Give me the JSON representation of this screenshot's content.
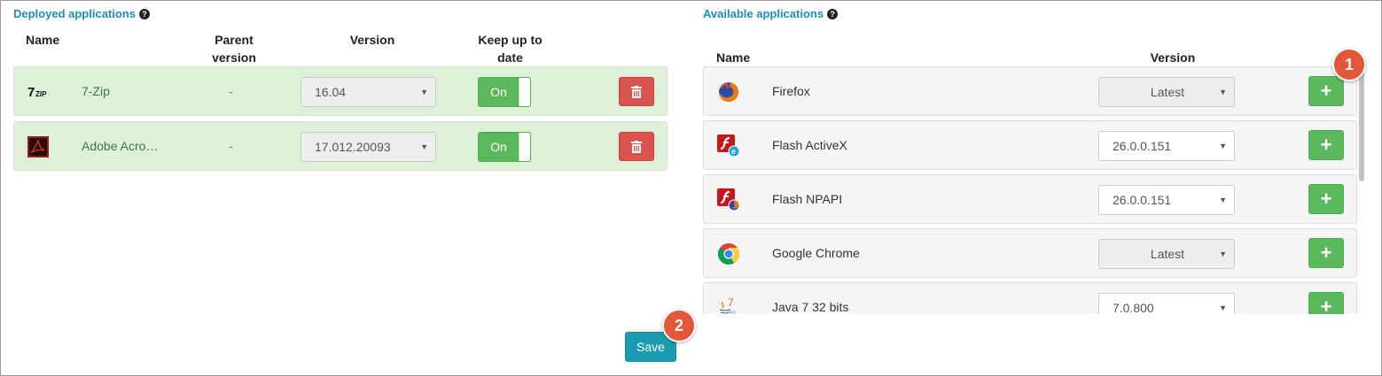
{
  "deployed": {
    "title": "Deployed applications",
    "help_icon": "?",
    "headers": {
      "name": "Name",
      "parent_version": "Parent version",
      "version": "Version",
      "keep_up_to_date": "Keep up to date"
    },
    "rows": [
      {
        "icon": "7zip-icon",
        "name": "7-Zip",
        "parent": "-",
        "version": "16.04",
        "toggle": "On"
      },
      {
        "icon": "adobe-acrobat-icon",
        "name": "Adobe Acro…",
        "parent": "-",
        "version": "17.012.20093",
        "toggle": "On"
      }
    ]
  },
  "available": {
    "title": "Available applications",
    "help_icon": "?",
    "headers": {
      "name": "Name",
      "version": "Version"
    },
    "rows": [
      {
        "icon": "firefox-icon",
        "name": "Firefox",
        "version": "Latest",
        "disabled": true
      },
      {
        "icon": "flash-activex-icon",
        "name": "Flash ActiveX",
        "version": "26.0.0.151",
        "disabled": false
      },
      {
        "icon": "flash-npapi-icon",
        "name": "Flash NPAPI",
        "version": "26.0.0.151",
        "disabled": false
      },
      {
        "icon": "google-chrome-icon",
        "name": "Google Chrome",
        "version": "Latest",
        "disabled": true
      },
      {
        "icon": "java-icon",
        "name": "Java 7 32 bits",
        "version": "7.0.800",
        "disabled": false
      }
    ],
    "add_label": "+"
  },
  "save_label": "Save",
  "badges": {
    "first": "1",
    "second": "2"
  },
  "colors": {
    "accent": "#1d8fb1",
    "success": "#5cb85c",
    "danger": "#d9534f",
    "badge": "#e2573a",
    "save": "#1a9bb0"
  }
}
